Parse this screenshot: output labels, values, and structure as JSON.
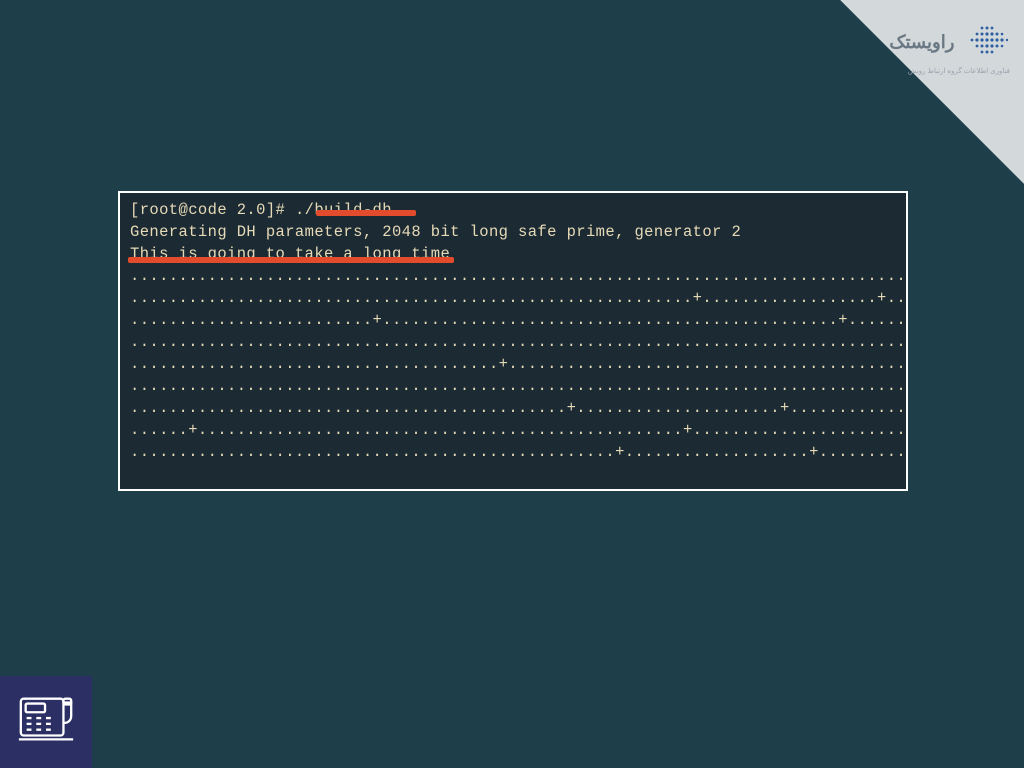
{
  "branding": {
    "logo_text": "راویستک",
    "tagline": "فناوری اطلاعات گروه ارتباط رویش"
  },
  "terminal": {
    "prompt": "[root@code 2.0]# ",
    "command": "./build-dh",
    "line_generating": "Generating DH parameters, 2048 bit long safe prime, generator 2",
    "line_longtime": "This is going to take a long time",
    "progress_lines": [
      "..................................................................................",
      "..........................................................+..................+....",
      ".........................+...............................................+........",
      "..................................................................................",
      "......................................+...........................................",
      "..................................................................................",
      ".............................................+.....................+..............",
      "......+..................................................+........................",
      "..................................................+...................+..........."
    ]
  },
  "colors": {
    "page_bg": "#1e3e4a",
    "terminal_bg": "#1c2b33",
    "terminal_fg": "#e6d9b7",
    "highlight": "#e24c2c",
    "badge_bg": "#2b2f64",
    "ribbon_bg": "#d3d8db"
  }
}
